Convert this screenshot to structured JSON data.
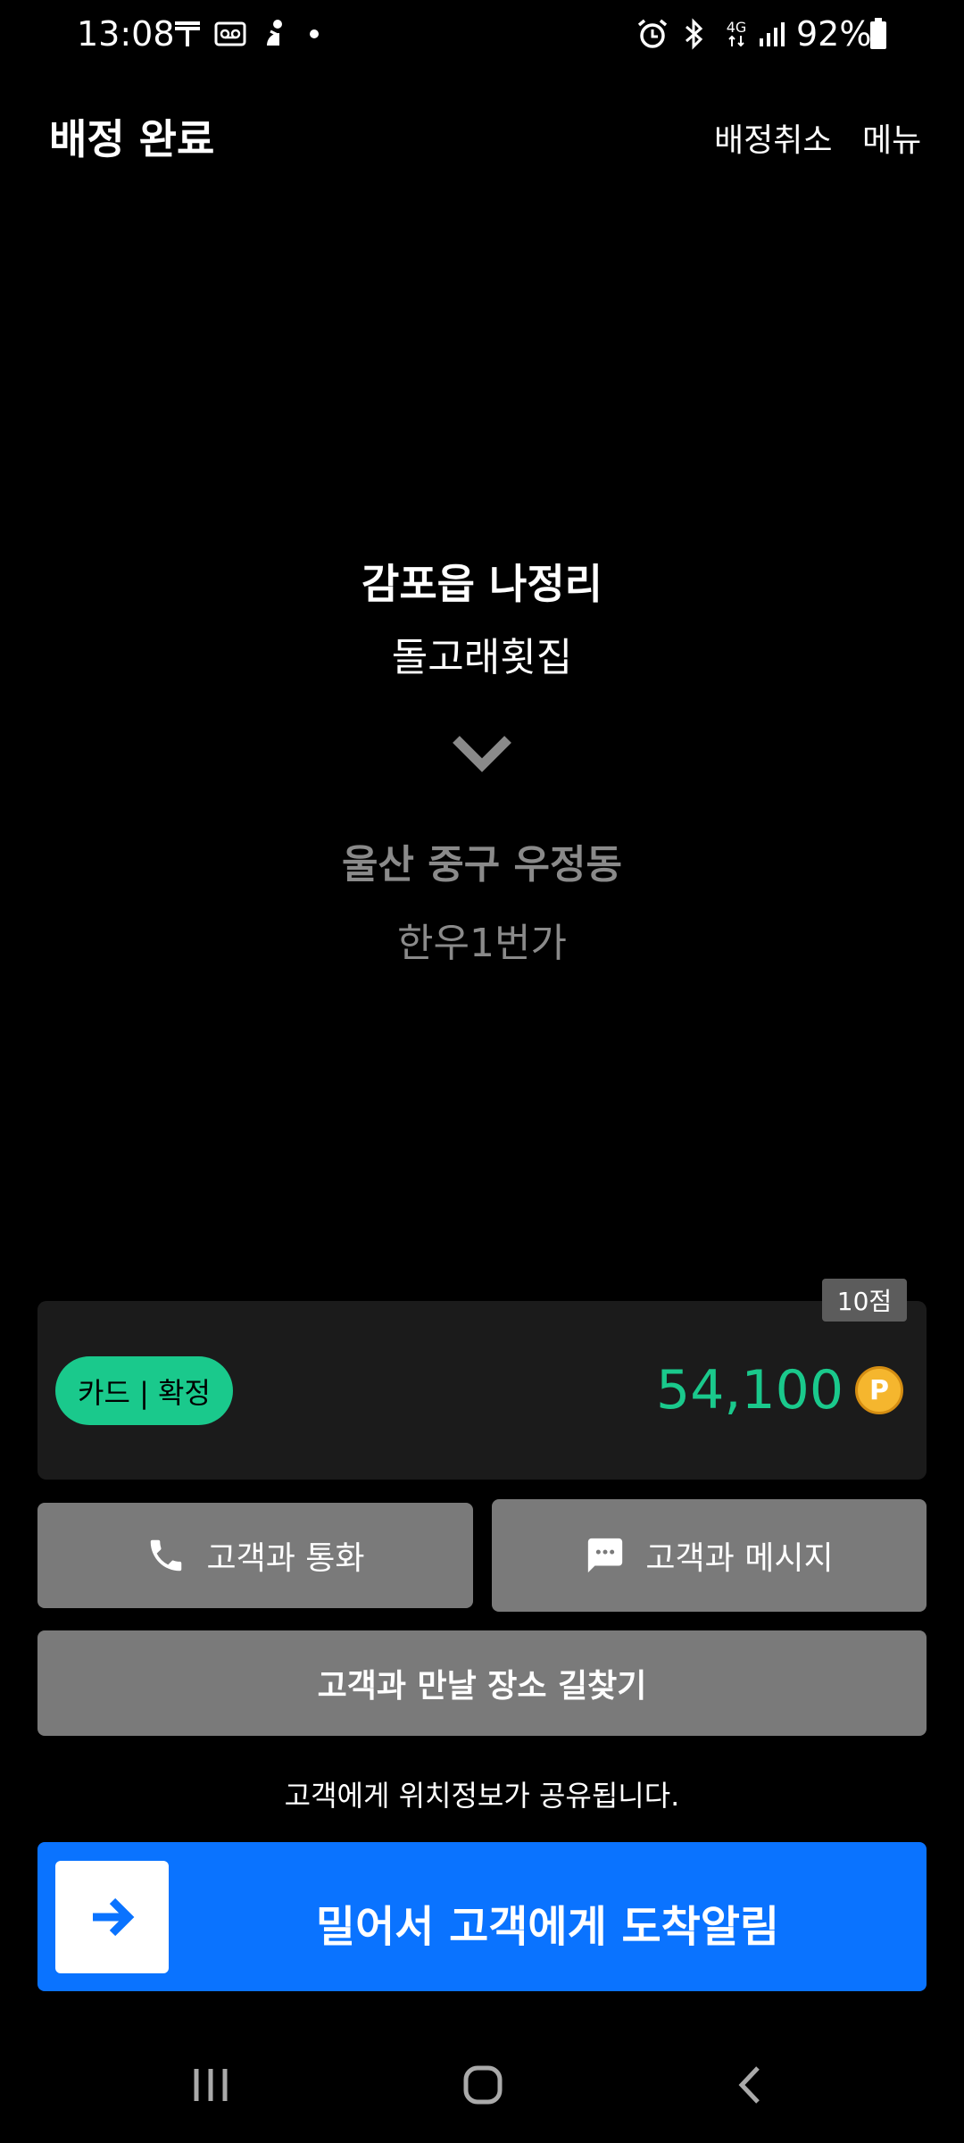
{
  "status_bar": {
    "time": "13:08",
    "battery": "92%",
    "icons": [
      "t-icon",
      "voicemail-icon",
      "figure-icon",
      "dot-icon",
      "alarm-icon",
      "bluetooth-icon",
      "4g-icon",
      "signal-icon",
      "battery-icon"
    ],
    "network_label": "4G"
  },
  "header": {
    "title": "배정 완료",
    "cancel_label": "배정취소",
    "menu_label": "메뉴"
  },
  "route": {
    "origin_area": "감포읍 나정리",
    "origin_place": "돌고래횟집",
    "destination_area": "울산 중구 우정동",
    "destination_place": "한우1번가"
  },
  "fare_card": {
    "score": "10점",
    "payment": "카드 | 확정",
    "fare": "54,100",
    "coin_label": "P",
    "accent_color": "#1ac98c"
  },
  "actions": {
    "call_label": "고객과 통화",
    "message_label": "고객과 메시지",
    "navigate_label": "고객과 만날 장소 길찾기"
  },
  "notice": "고객에게 위치정보가 공유됩니다.",
  "slider": {
    "label": "밀어서 고객에게 도착알림",
    "color": "#0a73ff"
  },
  "system_nav": [
    "recents-icon",
    "home-icon",
    "back-icon"
  ]
}
